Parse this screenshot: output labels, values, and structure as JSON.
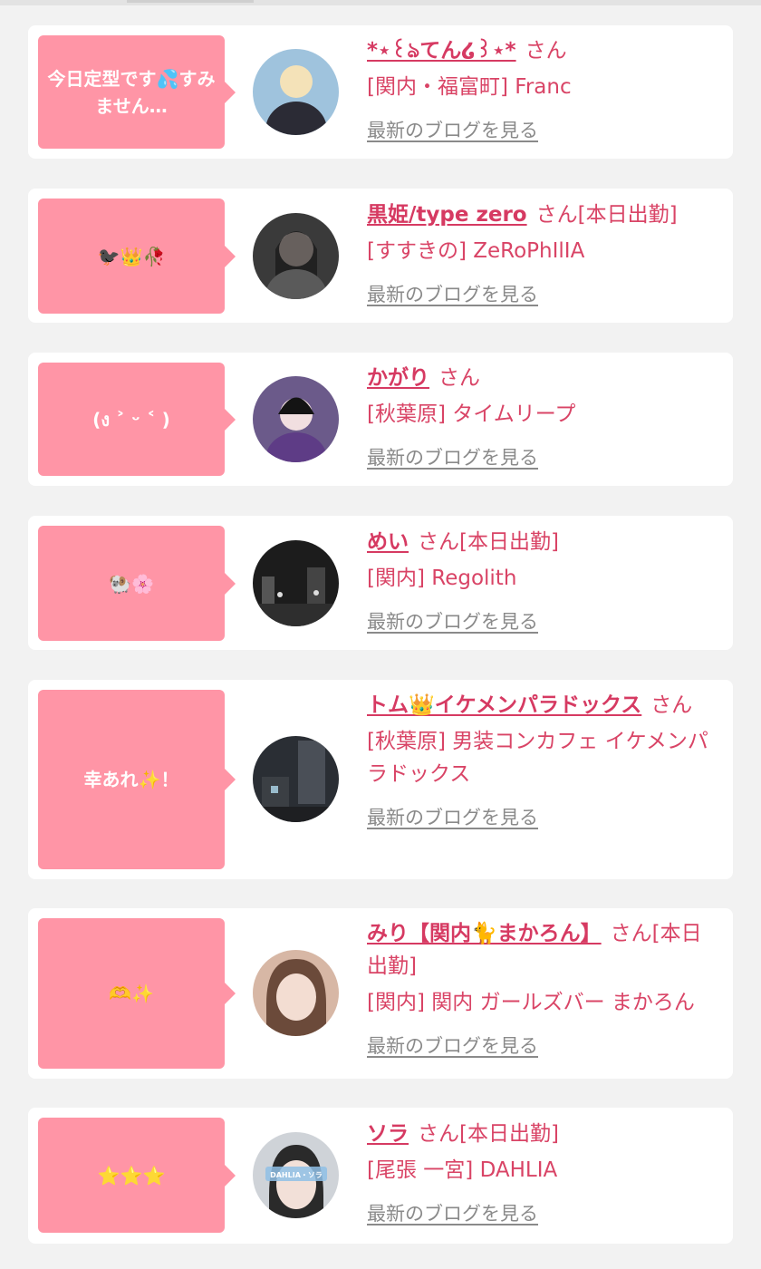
{
  "entries": [
    {
      "message": "今日定型です💦すみません…",
      "name": "*⋆꒰ঌてん໒꒱⋆*",
      "honorific": "さん",
      "shop": "[関内・福富町] Franc",
      "blog_link": "最新のブログを見る",
      "avatar_color": "#9fc3dd"
    },
    {
      "message": "🐦‍⬛👑🥀",
      "name": "黒姫/type zero",
      "honorific": "さん[本日出勤]",
      "shop": "[すすきの] ZeRoPhIlIA",
      "blog_link": "最新のブログを見る",
      "avatar_color": "#3a3a3a"
    },
    {
      "message": "(ง ˃ ᵕ ˂ )",
      "name": "かがり",
      "honorific": "さん",
      "shop": "[秋葉原] タイムリープ",
      "blog_link": "最新のブログを見る",
      "avatar_color": "#6b5a8a"
    },
    {
      "message": "🐏🌸",
      "name": "めい",
      "honorific": "さん[本日出勤]",
      "shop": "[関内] Regolith",
      "blog_link": "最新のブログを見る",
      "avatar_color": "#1c1c1c"
    },
    {
      "message": "幸あれ✨！",
      "name": "トム👑イケメンパラドックス",
      "honorific": "さん",
      "shop": "[秋葉原] 男装コンカフェ イケメンパラドックス",
      "blog_link": "最新のブログを見る",
      "avatar_color": "#2a2e34"
    },
    {
      "message": "🫶✨",
      "name": "みり【関内🐈まかろん】",
      "honorific": "さん[本日出勤]",
      "shop": "[関内] 関内 ガールズバー まかろん",
      "blog_link": "最新のブログを見る",
      "avatar_color": "#d7b7a5"
    },
    {
      "message": "⭐️⭐️⭐️",
      "name": "ソラ",
      "honorific": "さん[本日出勤]",
      "shop": "[尾張 一宮] DAHLIA",
      "blog_link": "最新のブログを見る",
      "avatar_color": "#cfd3d8",
      "avatar_caption": "DAHLIA・ソラ"
    }
  ]
}
